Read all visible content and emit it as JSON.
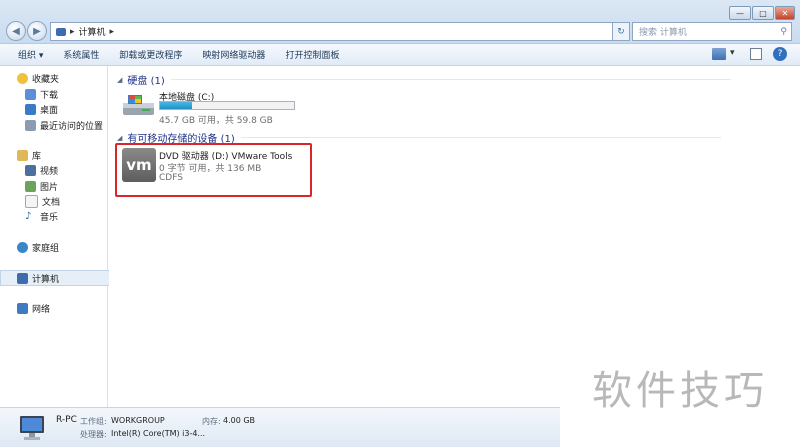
{
  "window": {
    "address_path": "计算机",
    "search_placeholder": "搜索 计算机",
    "controls": {
      "minimize": "—",
      "maximize": "□",
      "close": "✕"
    }
  },
  "toolbar": {
    "items": [
      "组织 ▾",
      "系统属性",
      "卸载或更改程序",
      "映射网络驱动器",
      "打开控制面板"
    ]
  },
  "sidebar": {
    "favorites": {
      "label": "收藏夹",
      "items": [
        "下载",
        "桌面",
        "最近访问的位置"
      ]
    },
    "libraries": {
      "label": "库",
      "items": [
        "视频",
        "图片",
        "文档",
        "音乐"
      ]
    },
    "homegroup": "家庭组",
    "computer": "计算机",
    "network": "网络"
  },
  "groups": {
    "hard_disks": {
      "header": "硬盘 (1)",
      "drive": {
        "name": "本地磁盘 (C:)",
        "free": "45.7 GB 可用，共 59.8 GB",
        "used_fraction": 0.24
      }
    },
    "removable": {
      "header": "有可移动存储的设备 (1)",
      "drive": {
        "name": "DVD 驱动器 (D:) VMware Tools",
        "free": "0 字节 可用，共 136 MB",
        "fs": "CDFS",
        "logo": "vm"
      }
    }
  },
  "details": {
    "pc_name": "R-PC",
    "workgroup_label": "工作组:",
    "workgroup": "WORKGROUP",
    "memory_label": "内存:",
    "memory": "4.00 GB",
    "cpu_label": "处理器:",
    "cpu": "Intel(R) Core(TM) i3-4..."
  },
  "watermark": "软件技巧",
  "colors": {
    "highlight_border": "#d9262a",
    "progress": "#2ea4d8",
    "group_header": "#1e3287"
  }
}
